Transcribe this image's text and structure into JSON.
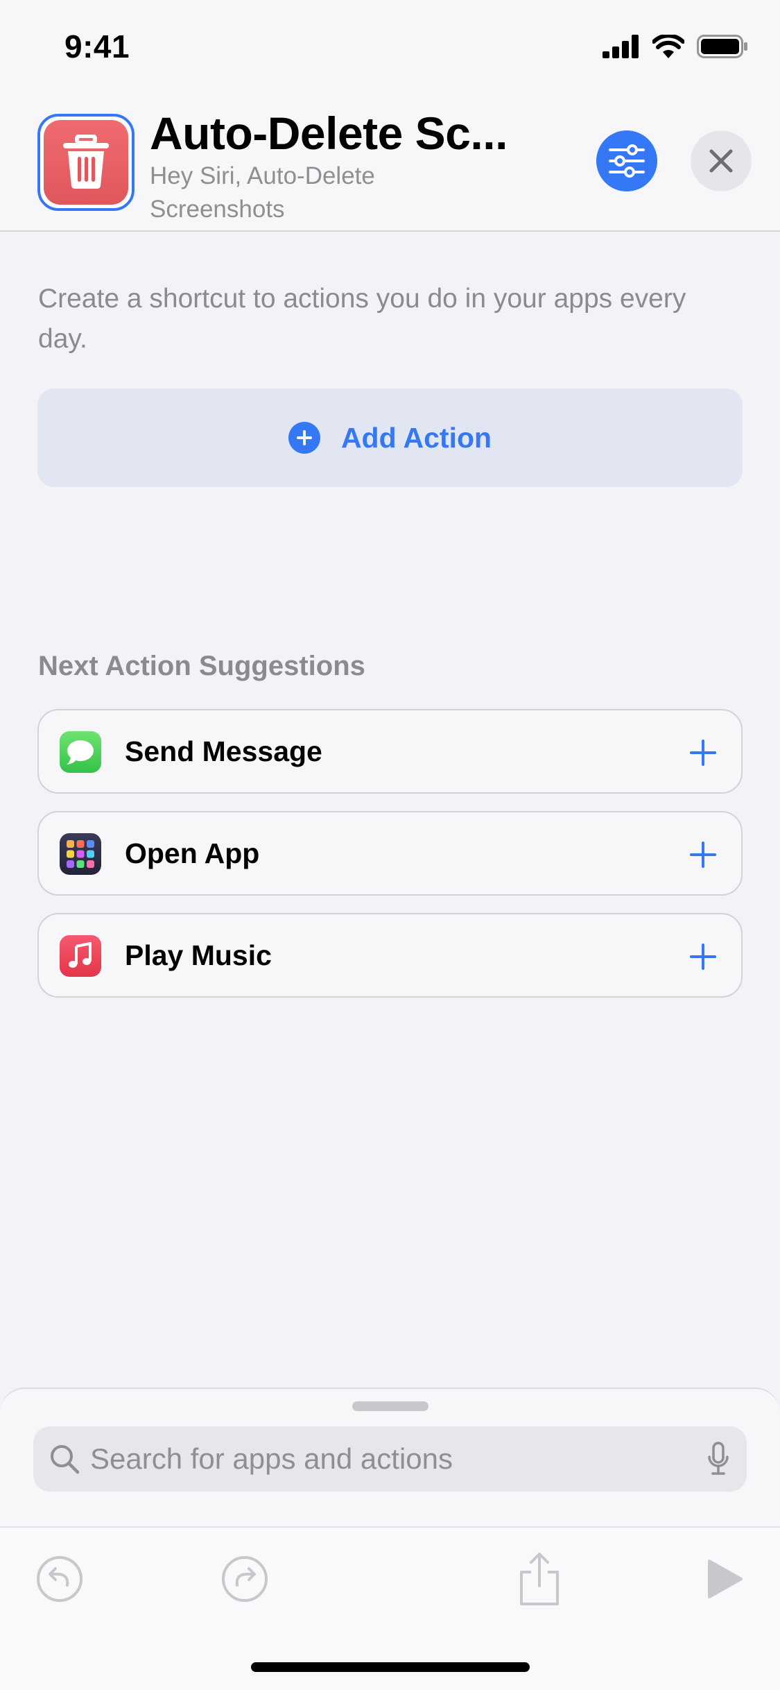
{
  "status_bar": {
    "time": "9:41"
  },
  "header": {
    "title": "Auto-Delete Sc...",
    "subtitle": "Hey Siri, Auto-Delete Screenshots"
  },
  "content": {
    "intro": "Create a shortcut to actions you do in your apps every day.",
    "add_action_label": "Add Action",
    "suggestions_title": "Next Action Suggestions",
    "suggestions": [
      {
        "label": "Send Message",
        "icon": "messages-app-icon"
      },
      {
        "label": "Open App",
        "icon": "app-grid-icon"
      },
      {
        "label": "Play Music",
        "icon": "music-app-icon"
      }
    ]
  },
  "search": {
    "placeholder": "Search for apps and actions"
  },
  "colors": {
    "accent": "#3478f6",
    "app_icon_red": "#e0575c",
    "messages_green": "#4cd964",
    "music_red": "#f0435a"
  }
}
